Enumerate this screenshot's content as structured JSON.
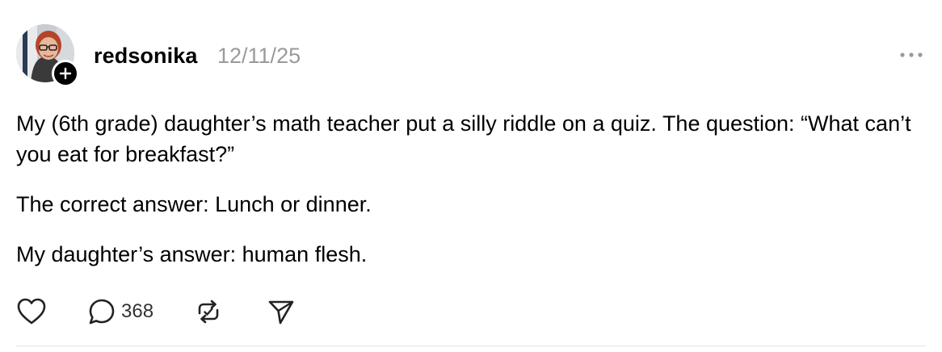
{
  "post": {
    "author": {
      "username": "redsonika",
      "avatar_icon": "profile-photo",
      "follow_icon": "plus-icon"
    },
    "timestamp": "12/11/25",
    "more_icon": "ellipsis-icon",
    "paragraphs": [
      "My (6th grade) daughter’s math teacher put a silly riddle on a quiz. The question: “What can’t you eat for breakfast?”",
      "The correct answer: Lunch or dinner.",
      "My daughter’s answer: human flesh."
    ],
    "actions": {
      "like_icon": "heart-icon",
      "reply_icon": "comment-icon",
      "reply_count": "368",
      "repost_icon": "repost-icon",
      "share_icon": "send-icon"
    }
  },
  "colors": {
    "text": "#000000",
    "muted": "#9a9a9a",
    "divider": "#e3e3e3"
  }
}
